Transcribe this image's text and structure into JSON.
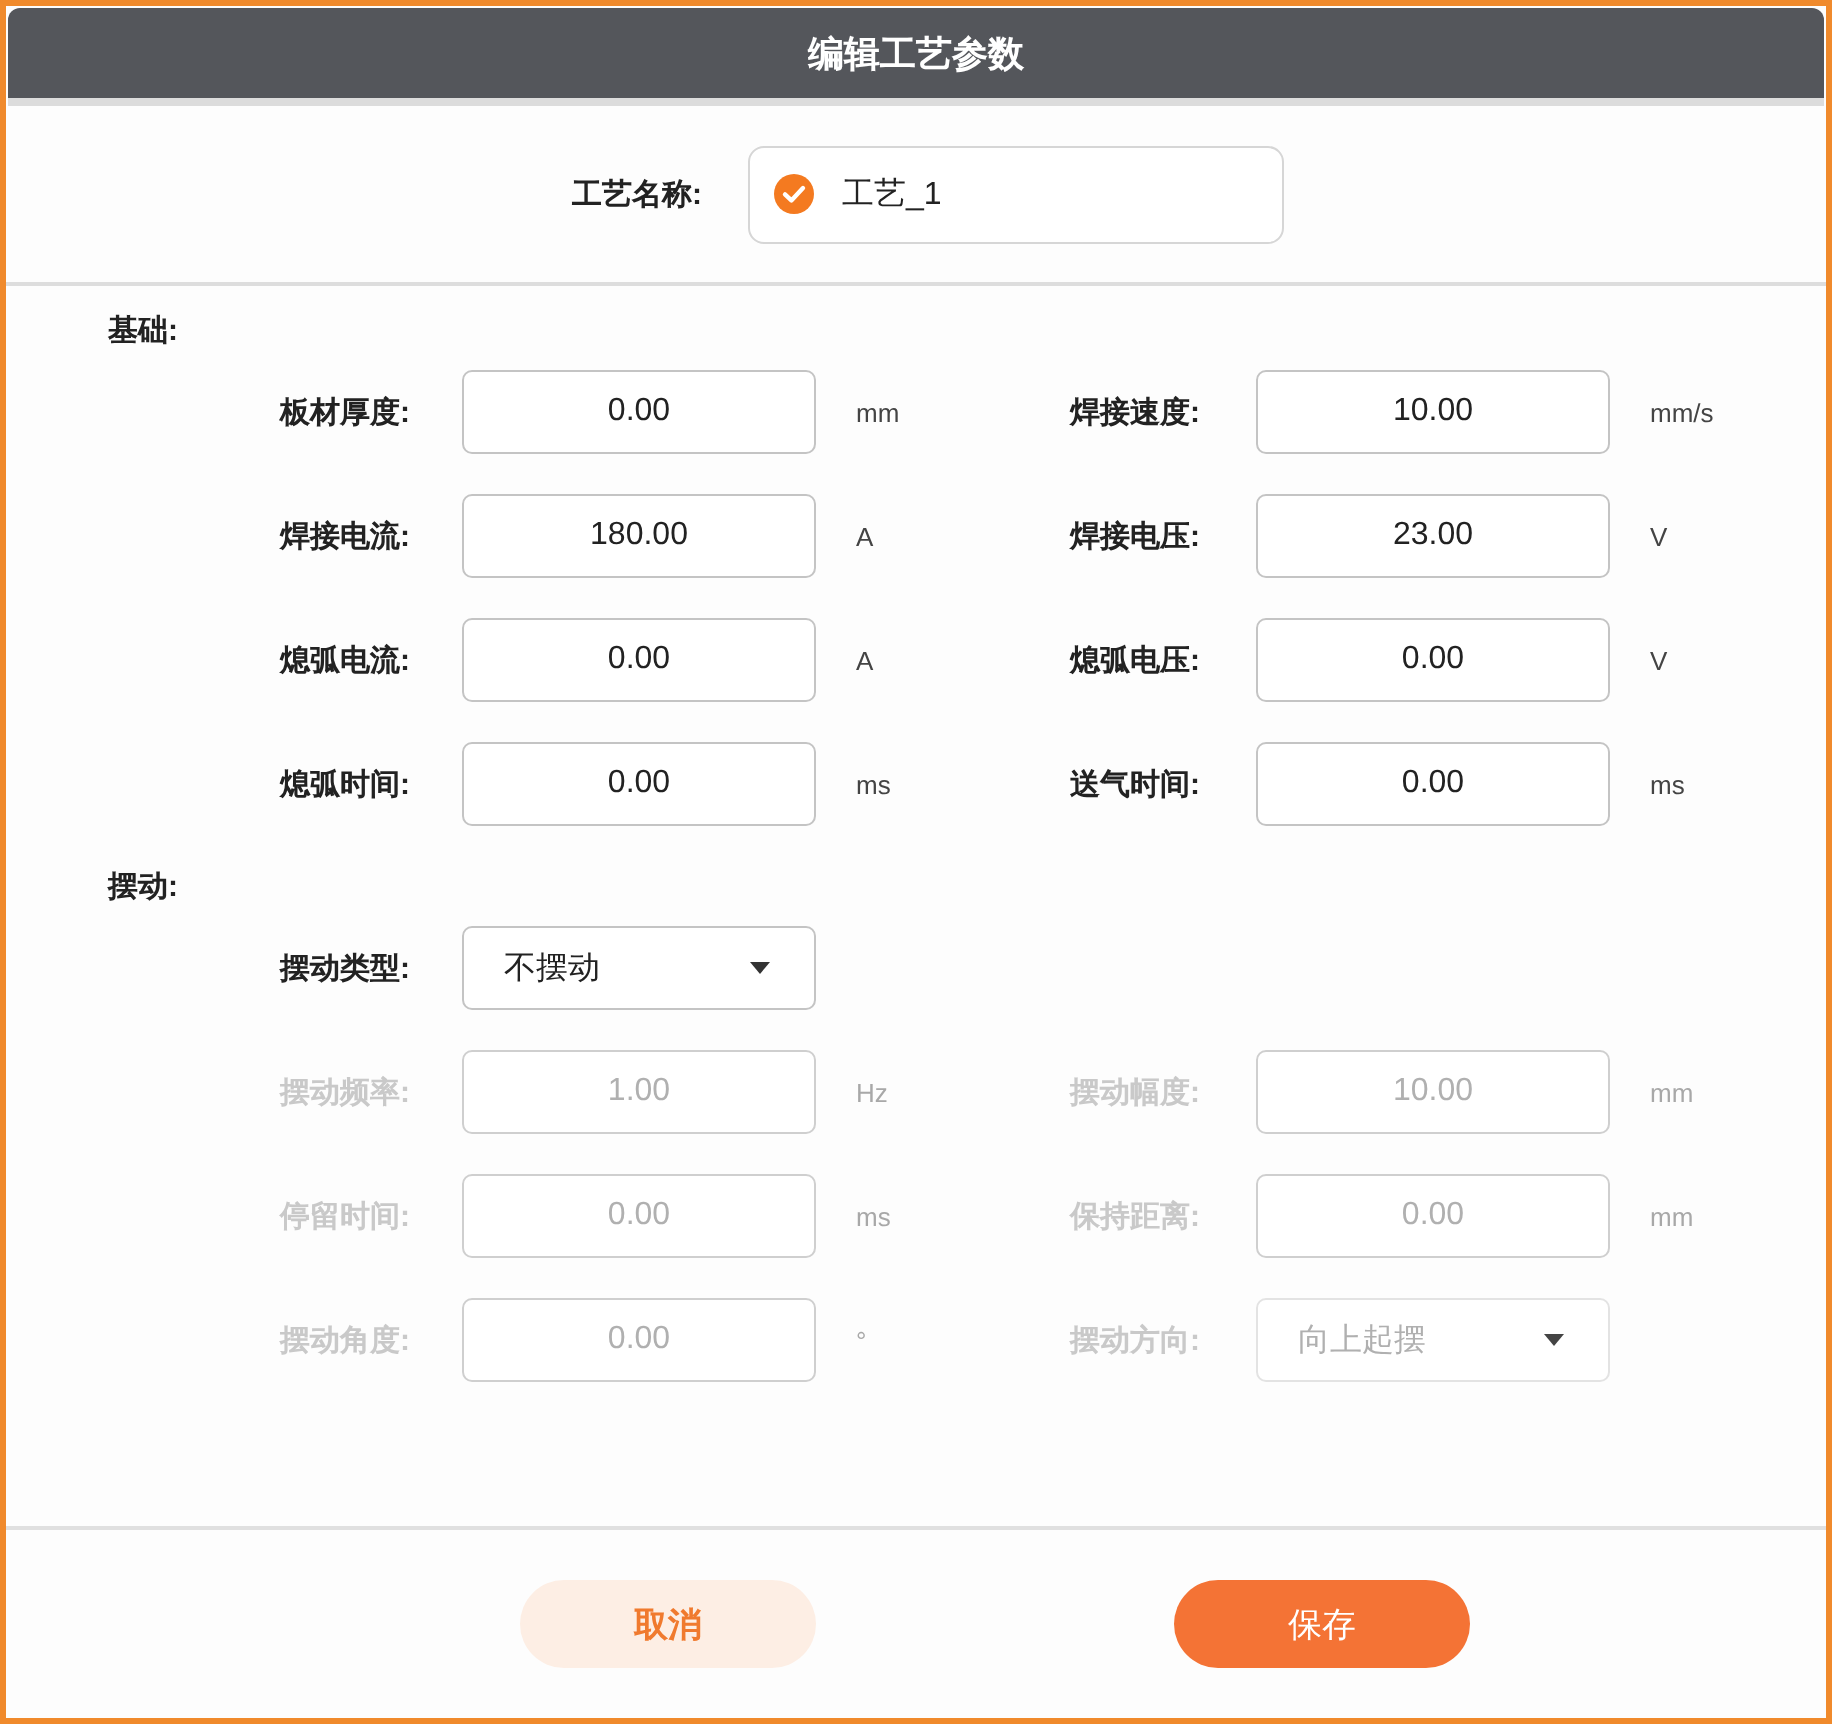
{
  "dialog": {
    "title": "编辑工艺参数"
  },
  "process_name": {
    "label": "工艺名称:",
    "value": "工艺_1",
    "checked": true
  },
  "sections": [
    {
      "title": "基础:",
      "rows": [
        {
          "fields": [
            {
              "kind": "input",
              "label": "板材厚度:",
              "value": "0.00",
              "unit": "mm",
              "disabled": false
            },
            {
              "kind": "input",
              "label": "焊接速度:",
              "value": "10.00",
              "unit": "mm/s",
              "disabled": false
            }
          ]
        },
        {
          "fields": [
            {
              "kind": "input",
              "label": "焊接电流:",
              "value": "180.00",
              "unit": "A",
              "disabled": false
            },
            {
              "kind": "input",
              "label": "焊接电压:",
              "value": "23.00",
              "unit": "V",
              "disabled": false
            }
          ]
        },
        {
          "fields": [
            {
              "kind": "input",
              "label": "熄弧电流:",
              "value": "0.00",
              "unit": "A",
              "disabled": false
            },
            {
              "kind": "input",
              "label": "熄弧电压:",
              "value": "0.00",
              "unit": "V",
              "disabled": false
            }
          ]
        },
        {
          "fields": [
            {
              "kind": "input",
              "label": "熄弧时间:",
              "value": "0.00",
              "unit": "ms",
              "disabled": false
            },
            {
              "kind": "input",
              "label": "送气时间:",
              "value": "0.00",
              "unit": "ms",
              "disabled": false
            }
          ]
        }
      ]
    },
    {
      "title": "摆动:",
      "rows": [
        {
          "fields": [
            {
              "kind": "select",
              "label": "摆动类型:",
              "value": "不摆动",
              "disabled": false
            }
          ]
        },
        {
          "fields": [
            {
              "kind": "input",
              "label": "摆动频率:",
              "value": "1.00",
              "unit": "Hz",
              "disabled": true
            },
            {
              "kind": "input",
              "label": "摆动幅度:",
              "value": "10.00",
              "unit": "mm",
              "disabled": true
            }
          ]
        },
        {
          "fields": [
            {
              "kind": "input",
              "label": "停留时间:",
              "value": "0.00",
              "unit": "ms",
              "disabled": true
            },
            {
              "kind": "input",
              "label": "保持距离:",
              "value": "0.00",
              "unit": "mm",
              "disabled": true
            }
          ]
        },
        {
          "fields": [
            {
              "kind": "input",
              "label": "摆动角度:",
              "value": "0.00",
              "unit": "°",
              "disabled": true
            },
            {
              "kind": "select",
              "label": "摆动方向:",
              "value": "向上起摆",
              "disabled": true
            }
          ]
        }
      ]
    }
  ],
  "buttons": [
    {
      "kind": "secondary",
      "label": "取消"
    },
    {
      "kind": "primary",
      "label": "保存"
    }
  ]
}
